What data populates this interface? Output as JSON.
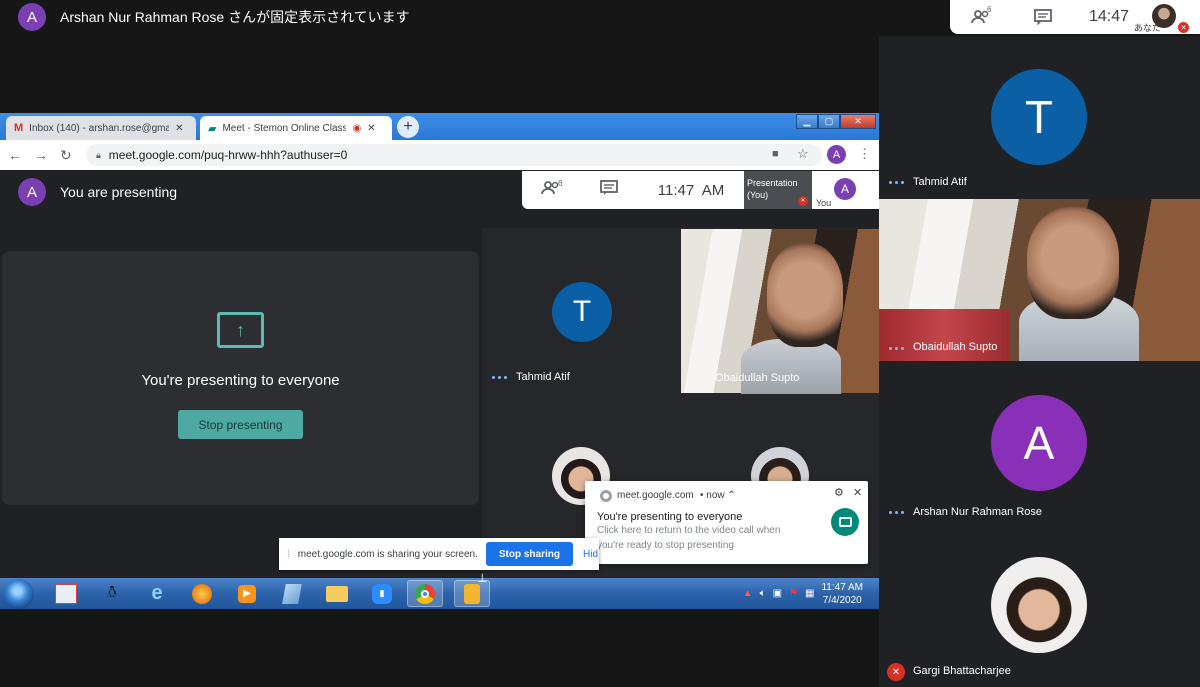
{
  "banner": {
    "avatar_letter": "A",
    "text": "Arshan Nur Rahman Rose さんが固定表示されています"
  },
  "top_toolbar": {
    "people_count": "6",
    "clock": "14:47",
    "me_label": "あなた"
  },
  "rail": {
    "participants": [
      {
        "name": "Tahmid Atif",
        "initial": "T",
        "color": "#0b5fa5"
      },
      {
        "name": "Obaidullah Supto"
      },
      {
        "name": "Arshan Nur Rahman Rose",
        "initial": "A",
        "color": "#8a2fb8"
      },
      {
        "name": "Gargi Bhattacharjee",
        "muted": true
      }
    ]
  },
  "browser": {
    "tabs": [
      {
        "label": "Inbox (140) - arshan.rose@gmail",
        "icon": "gmail-icon"
      },
      {
        "label": "Meet - Stemon Online Class",
        "icon": "meet-icon"
      }
    ],
    "url": "meet.google.com/puq-hrww-hhh?authuser=0",
    "profile_letter": "A"
  },
  "meet": {
    "presenting_label": "You are presenting",
    "avatar_letter": "A",
    "present_card_title": "You're presenting to everyone",
    "stop_button": "Stop presenting",
    "inner_toolbar": {
      "people_count": "6",
      "clock": "11:47  AM",
      "presentation_label_1": "Presentation",
      "presentation_label_2": "(You)",
      "you_label": "You",
      "avatar_letter": "A"
    },
    "tiles": [
      {
        "name": "Tahmid Atif",
        "initial": "T"
      },
      {
        "name": "Obaidullah Supto"
      }
    ]
  },
  "notification": {
    "source": "meet.google.com",
    "time": "• now ⌃",
    "title": "You're presenting to everyone",
    "body_1": "Click here to return to the video call when",
    "body_2": "you're ready to stop presenting"
  },
  "share_bar": {
    "text": "meet.google.com is sharing your screen.",
    "stop_button": "Stop sharing",
    "hide_button": "Hid"
  },
  "taskbar": {
    "time": "11:47 AM",
    "date": "7/4/2020"
  },
  "colors": {
    "accent_teal": "#4ea9a3",
    "meet_dark": "#202124",
    "blue_button": "#1a73e8",
    "avatar_purple": "#7b3fb4"
  }
}
